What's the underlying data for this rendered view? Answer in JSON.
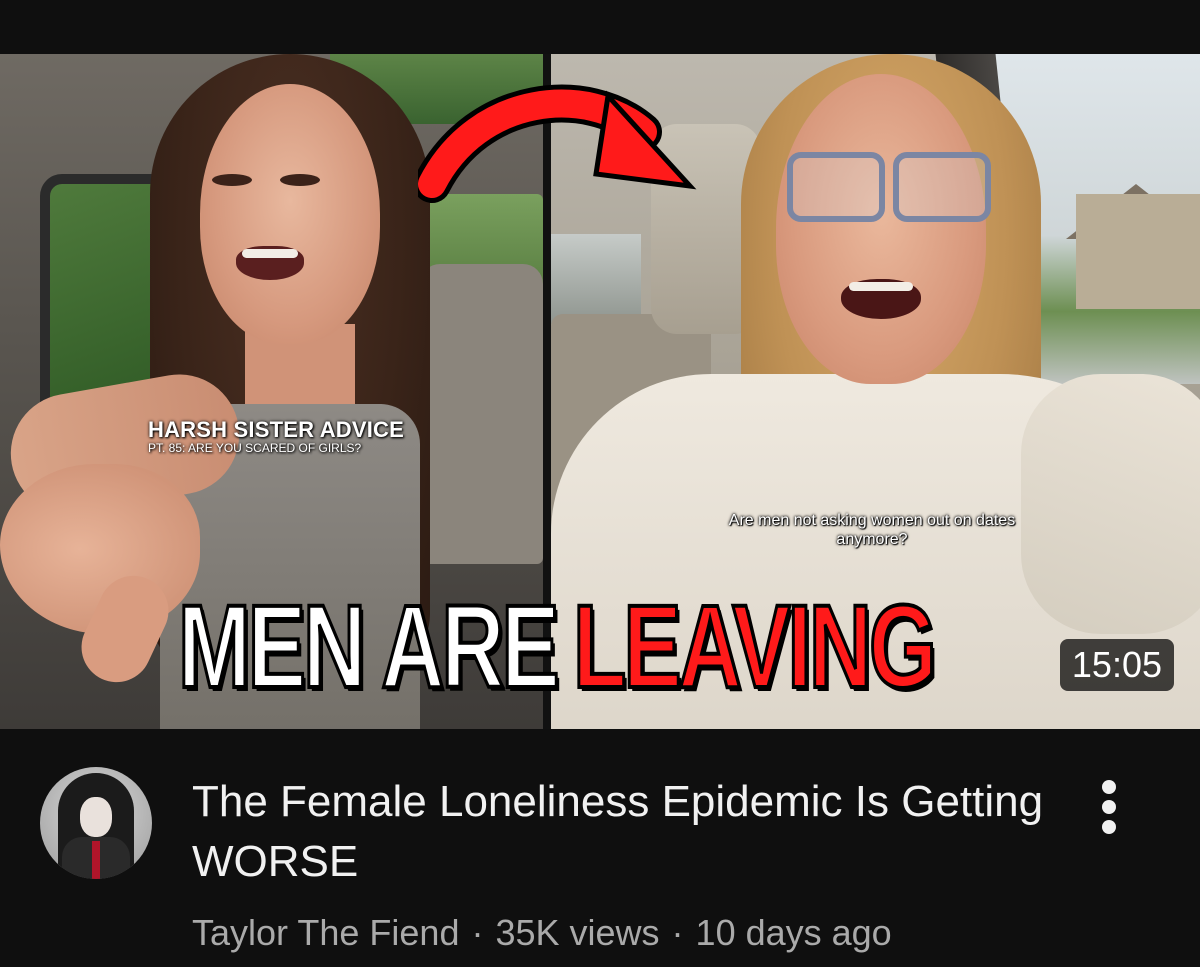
{
  "video": {
    "thumbnail": {
      "caption_left_title": "HARSH SISTER ADVICE",
      "caption_left_subtitle": "PT. 85: ARE YOU SCARED OF GIRLS?",
      "caption_right": "Are men not asking women out on dates anymore?",
      "headline_white": "MEN ARE",
      "headline_red": "LEAVING",
      "duration": "15:05"
    },
    "title": "The Female Loneliness Epidemic Is Getting WORSE",
    "channel": "Taylor The Fiend",
    "views": "35K views",
    "age": "10 days ago",
    "separator": "·",
    "more_icon": "more-vert-icon"
  },
  "colors": {
    "background": "#0f0f0f",
    "title": "#f1f1f1",
    "meta": "#aaaaaa",
    "headline_red": "#ff1a1a",
    "arrow_red": "#ff1a1a"
  }
}
